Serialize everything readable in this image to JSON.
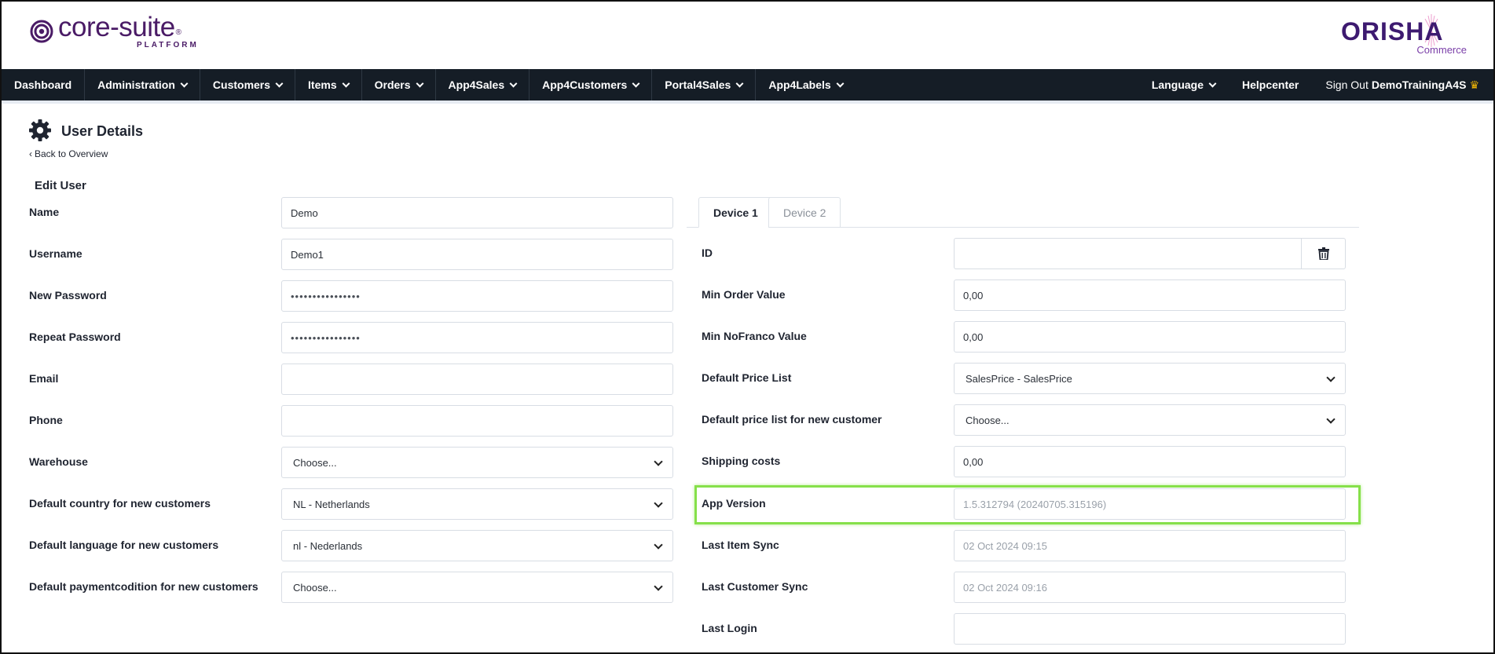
{
  "brand": {
    "core_suite": "core-suite",
    "core_suite_reg": "®",
    "core_suite_sub": "PLATFORM",
    "orisha": "ORISHA",
    "orisha_sub": "Commerce"
  },
  "nav": {
    "items": [
      {
        "label": "Dashboard",
        "dropdown": false
      },
      {
        "label": "Administration",
        "dropdown": true
      },
      {
        "label": "Customers",
        "dropdown": true
      },
      {
        "label": "Items",
        "dropdown": true
      },
      {
        "label": "Orders",
        "dropdown": true
      },
      {
        "label": "App4Sales",
        "dropdown": true
      },
      {
        "label": "App4Customers",
        "dropdown": true
      },
      {
        "label": "Portal4Sales",
        "dropdown": true
      },
      {
        "label": "App4Labels",
        "dropdown": true
      }
    ],
    "language": "Language",
    "helpcenter": "Helpcenter",
    "sign_out": "Sign Out",
    "user": "DemoTrainingA4S"
  },
  "page": {
    "title": "User Details",
    "back": "Back to Overview",
    "section": "Edit User"
  },
  "left_form": [
    {
      "label": "Name",
      "value": "Demo",
      "type": "text"
    },
    {
      "label": "Username",
      "value": "Demo1",
      "type": "text"
    },
    {
      "label": "New Password",
      "value": "••••••••••••••••",
      "type": "password"
    },
    {
      "label": "Repeat Password",
      "value": "••••••••••••••••",
      "type": "password"
    },
    {
      "label": "Email",
      "value": "",
      "type": "text"
    },
    {
      "label": "Phone",
      "value": "",
      "type": "text"
    },
    {
      "label": "Warehouse",
      "value": "Choose...",
      "type": "select"
    },
    {
      "label": "Default country for new customers",
      "value": "NL - Netherlands",
      "type": "select"
    },
    {
      "label": "Default language for new customers",
      "value": "nl - Nederlands",
      "type": "select"
    },
    {
      "label": "Default paymentcodition for new customers",
      "value": "Choose...",
      "type": "select"
    }
  ],
  "tabs": [
    "Device 1",
    "Device 2"
  ],
  "right_form": [
    {
      "label": "ID",
      "value": "",
      "type": "text"
    },
    {
      "label": "Min Order Value",
      "value": "0,00",
      "type": "text"
    },
    {
      "label": "Min NoFranco Value",
      "value": "0,00",
      "type": "text"
    },
    {
      "label": "Default Price List",
      "value": "SalesPrice - SalesPrice",
      "type": "select"
    },
    {
      "label": "Default price list for new customer",
      "value": "Choose...",
      "type": "select"
    },
    {
      "label": "Shipping costs",
      "value": "0,00",
      "type": "text"
    },
    {
      "label": "App Version",
      "value": "1.5.312794 (20240705.315196)",
      "type": "readonly"
    },
    {
      "label": "Last Item Sync",
      "value": "02 Oct 2024 09:15",
      "type": "readonly"
    },
    {
      "label": "Last Customer Sync",
      "value": "02 Oct 2024 09:16",
      "type": "readonly"
    },
    {
      "label": "Last Login",
      "value": "",
      "type": "readonly"
    }
  ],
  "colors": {
    "nav_bg": "#151d26",
    "brand": "#4a1b66",
    "highlight": "#86e04a"
  }
}
